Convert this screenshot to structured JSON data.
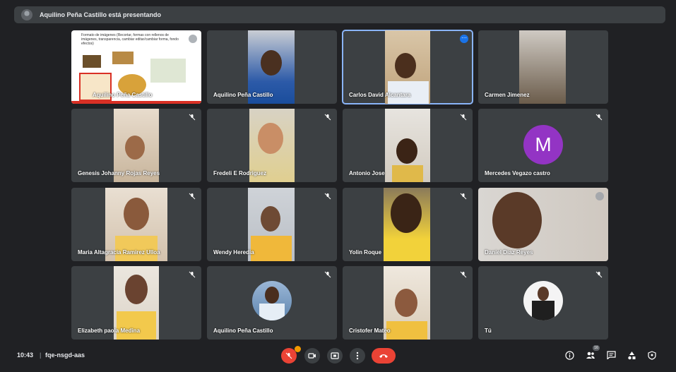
{
  "banner": {
    "text": "Aquilino Peña Castillo está presentando"
  },
  "tiles": [
    {
      "name": "Aquilino Peña Castillo",
      "kind": "slide"
    },
    {
      "name": "Aquilino Peña Castillo",
      "kind": "video"
    },
    {
      "name": "Carlos David Alcantara",
      "kind": "video",
      "speaking": true
    },
    {
      "name": "Carmen Jimenez",
      "kind": "video"
    },
    {
      "name": "Genesis Johanny Rojas Reyes",
      "kind": "video",
      "muted": true
    },
    {
      "name": "Fredeli E Rodriguez",
      "kind": "video",
      "muted": true
    },
    {
      "name": "Antonio Jose",
      "kind": "video",
      "muted": true
    },
    {
      "name": "Mercedes Vegazo castro",
      "kind": "letter",
      "letter": "M",
      "muted": true
    },
    {
      "name": "Maria Altagracia Ramirez Ulloa",
      "kind": "video",
      "muted": true
    },
    {
      "name": "Wendy Heredia",
      "kind": "video",
      "muted": true
    },
    {
      "name": "Yolin Roque",
      "kind": "video",
      "muted": true
    },
    {
      "name": "Daniel Diaz Reyes",
      "kind": "video"
    },
    {
      "name": "Elizabeth paola Medina",
      "kind": "video",
      "muted": true
    },
    {
      "name": "Aquilino Peña Castillo",
      "kind": "photo",
      "muted": true
    },
    {
      "name": "Cristofer Mateo",
      "kind": "video",
      "muted": true
    },
    {
      "name": "Tú",
      "kind": "photo",
      "muted": true
    }
  ],
  "slide": {
    "title": "Formato de imágenes (Recortar, formas con rellenos de imágenes, transparencia, cambiar editar/cambiar forma, fondo efectos)"
  },
  "bottombar": {
    "time": "10:43",
    "separator": "|",
    "meeting_code": "fqe-nsgd-aas",
    "participants_count": "16"
  },
  "colors": {
    "background": "#202124",
    "tile": "#3c4043",
    "end_call": "#ea4335",
    "speaking_outline": "#8ab4f8",
    "avatar_purple": "#9334c4"
  },
  "icons": [
    "mic-off-icon",
    "camera-icon",
    "present-icon",
    "more-options-icon",
    "end-call-icon",
    "info-icon",
    "people-icon",
    "chat-icon",
    "activities-icon",
    "host-controls-icon"
  ]
}
